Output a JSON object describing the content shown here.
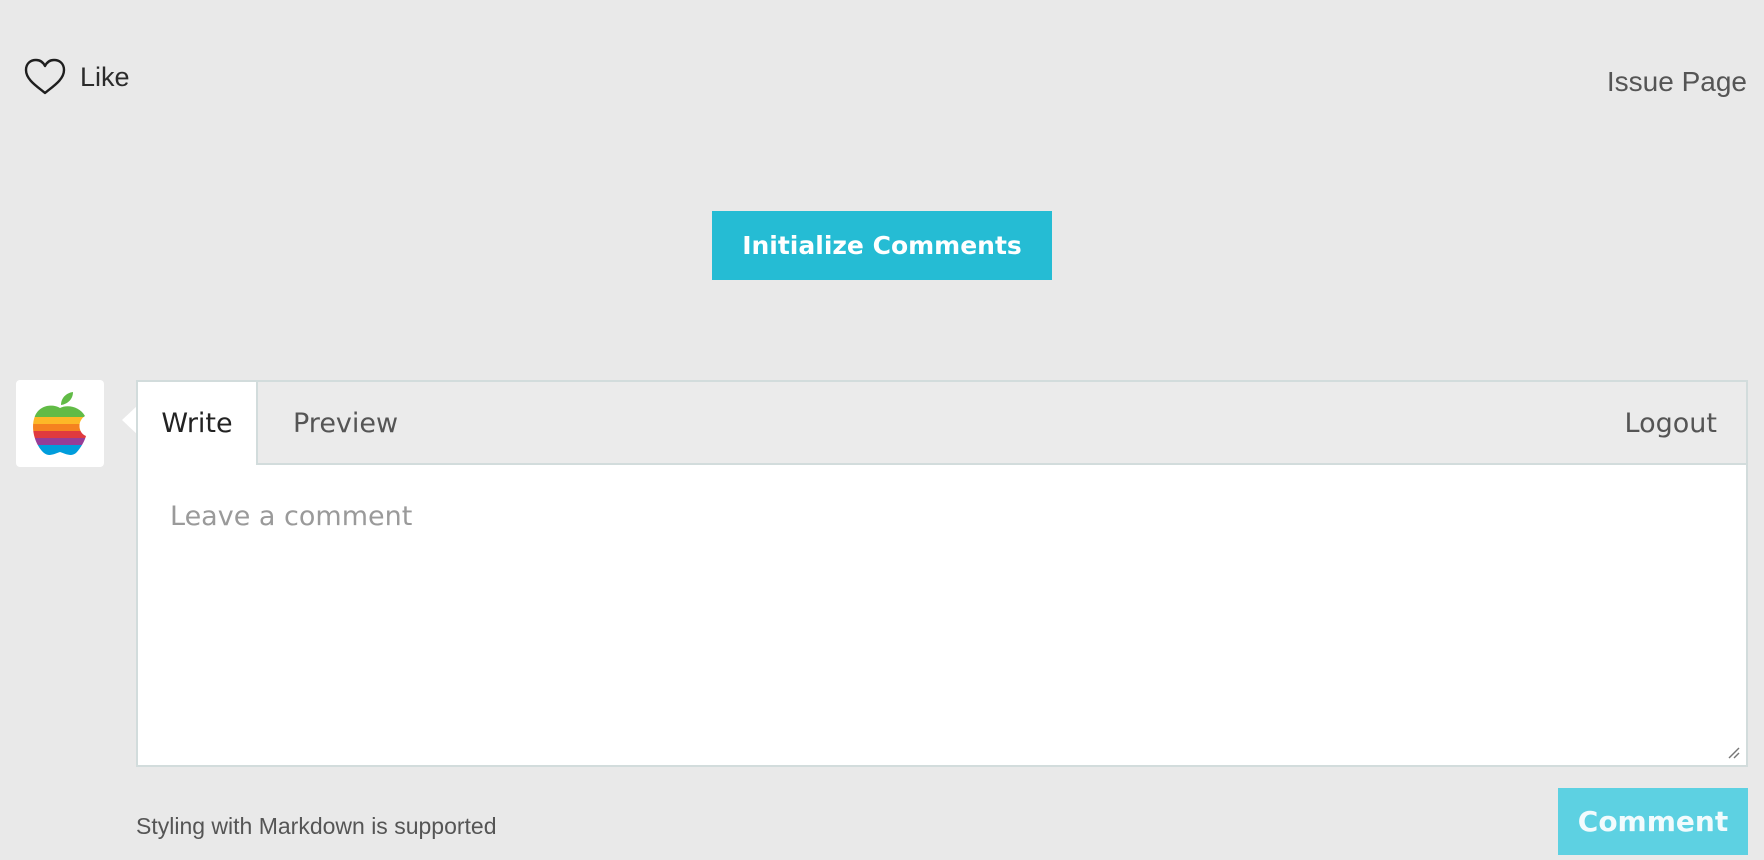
{
  "header": {
    "like_label": "Like",
    "issue_page_label": "Issue Page"
  },
  "actions": {
    "initialize_label": "Initialize Comments"
  },
  "editor": {
    "tabs": [
      {
        "label": "Write",
        "active": true
      },
      {
        "label": "Preview",
        "active": false
      }
    ],
    "logout_label": "Logout",
    "placeholder": "Leave a comment",
    "value": ""
  },
  "footer": {
    "markdown_note": "Styling with Markdown is supported",
    "comment_label": "Comment"
  },
  "icons": {
    "like": "heart-outline-icon",
    "avatar": "rainbow-apple-logo",
    "resize": "resize-grip-icon"
  },
  "colors": {
    "page_background": "#e9e9e9",
    "primary_button": "#25bcd4",
    "disabled_button": "#5dd1e2",
    "border": "#d2dcdc"
  }
}
